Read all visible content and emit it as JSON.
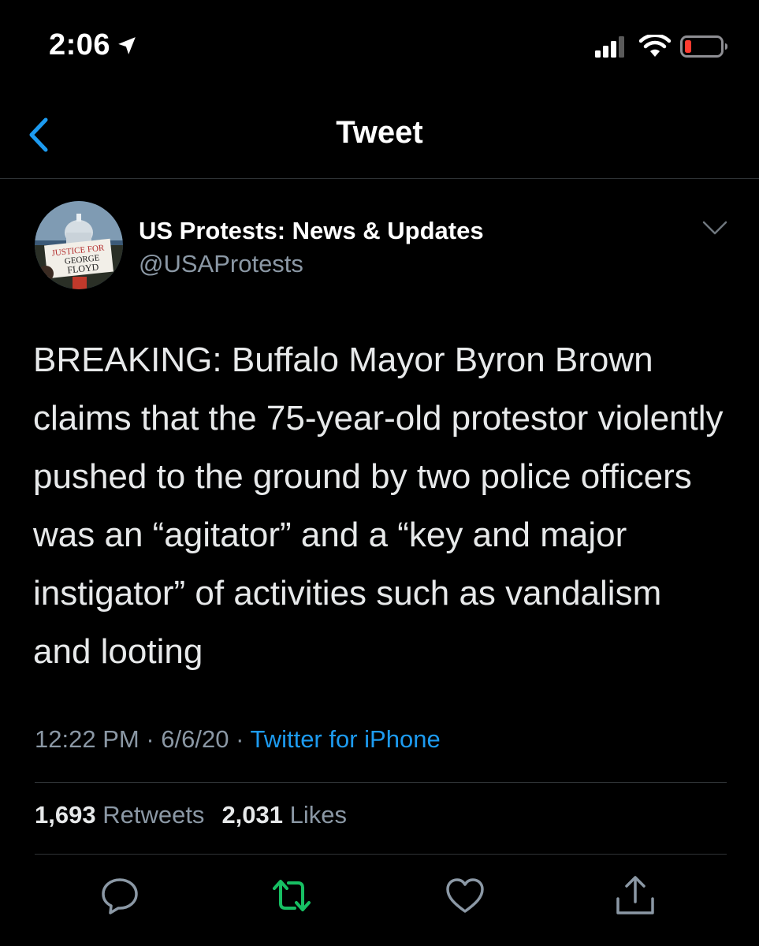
{
  "status_bar": {
    "time": "2:06",
    "icons": [
      "location-arrow-icon",
      "signal-icon",
      "wifi-icon",
      "battery-low-icon"
    ]
  },
  "nav": {
    "title": "Tweet",
    "back_icon": "chevron-left-icon"
  },
  "tweet": {
    "author_name": "US Protests: News & Updates",
    "author_handle": "@USAProtests",
    "avatar_text": [
      "JUSTICE FOR",
      "GEORGE",
      "FLOYD"
    ],
    "text": "BREAKING: Buffalo Mayor Byron Brown claims that the 75-year-old protestor violently pushed to the ground by two police officers was an “agitator” and a “key and major instigator” of activities such as vandalism and looting",
    "time": "12:22 PM",
    "date": "6/6/20",
    "separator": " · ",
    "source": "Twitter for iPhone"
  },
  "stats": {
    "retweets_count": "1,693",
    "retweets_label": "Retweets",
    "likes_count": "2,031",
    "likes_label": "Likes"
  },
  "actions": [
    "reply-icon",
    "retweet-icon",
    "like-icon",
    "share-icon"
  ],
  "colors": {
    "background": "#000000",
    "accent": "#1d9bf0",
    "retweet": "#17bf63",
    "secondary_text": "#8b98a5",
    "battery_low": "#ff3b30"
  }
}
